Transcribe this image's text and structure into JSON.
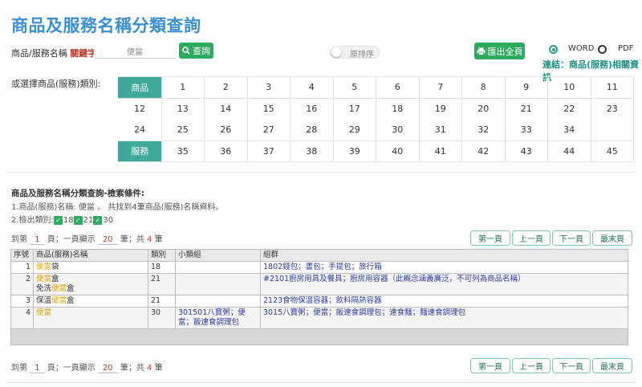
{
  "header": {
    "title": "商品及服務名稱分類查詢"
  },
  "search": {
    "label": "商品/服務名稱",
    "keyword_label": "關鍵字:",
    "keyword_value": "便當",
    "query_button": "查詢",
    "sort_toggle_label": "原排序",
    "export_button": "匯出全頁"
  },
  "export_format": {
    "options": [
      "WORD",
      "PDF"
    ],
    "selected": "WORD"
  },
  "related_link": "連結：商品(服務)相關資訊",
  "class_picker": {
    "label": "或選擇商品(服務)類別:",
    "goods_header": "商品",
    "services_header": "服務",
    "goods_rows": [
      [
        "1",
        "2",
        "3",
        "4",
        "5",
        "6",
        "7",
        "8",
        "9",
        "10",
        "11"
      ],
      [
        "12",
        "13",
        "14",
        "15",
        "16",
        "17",
        "18",
        "19",
        "20",
        "21",
        "22",
        "23"
      ],
      [
        "24",
        "25",
        "26",
        "27",
        "28",
        "29",
        "30",
        "31",
        "32",
        "33",
        "34",
        ""
      ]
    ],
    "services_row": [
      "35",
      "36",
      "37",
      "38",
      "39",
      "40",
      "41",
      "42",
      "43",
      "44",
      "45"
    ]
  },
  "conditions": {
    "title": "商品及服務名稱分類查詢-檢索條件:",
    "line1": "1.商品(服務)名稱: 便當 。 共找到4筆商品(服務)名稱資料。",
    "line2_label": "2.檢出類別:",
    "classes": [
      "18",
      "21",
      "30"
    ]
  },
  "pager": {
    "to_label": "到第",
    "page": "1",
    "page_suffix": "頁；一頁顯示",
    "per_page": "20",
    "total_prefix": "筆；共",
    "total": "4",
    "total_suffix": "筆",
    "buttons": [
      "第一頁",
      "上一頁",
      "下一頁",
      "最末頁"
    ]
  },
  "results": {
    "columns": [
      "序號",
      "商品(服務)名稱",
      "類別",
      "小類組",
      "組群"
    ],
    "rows": [
      {
        "idx": "1",
        "name_pre": "",
        "name_hl": "便當",
        "name_post": "袋",
        "name_line2": "",
        "class": "18",
        "subgroup": "",
        "group": "1802錢包；書包；手提包；旅行箱"
      },
      {
        "idx": "2",
        "name_pre": "",
        "name_hl": "便當",
        "name_post": "盒",
        "name_line2_pre": "免洗",
        "name_line2_hl": "便當",
        "name_line2_post": "盒",
        "class": "21",
        "subgroup": "",
        "group": "#2101廚房用具及餐具；廚房用容器（此概念涵義廣泛，不可列為商品名稱）"
      },
      {
        "idx": "3",
        "name_pre": "保溫",
        "name_hl": "便當",
        "name_post": "盒",
        "name_line2": "",
        "class": "21",
        "subgroup": "",
        "group": "2123食物保溫容器；飲料隔熱容器"
      },
      {
        "idx": "4",
        "name_pre": "",
        "name_hl": "便當",
        "name_post": "",
        "name_line2": "",
        "class": "30",
        "subgroup": "301501八寶粥；便當；飯速食調理包",
        "group": "3015八寶粥；便當；飯速食調理包；速食麵；麵速食調理包"
      }
    ]
  },
  "colors": {
    "title": "#3a8fd0",
    "accent": "#3fa99a",
    "button_green": "#2eab5f",
    "highlight": "#e0a000",
    "link_blue": "#2a3aa0"
  }
}
